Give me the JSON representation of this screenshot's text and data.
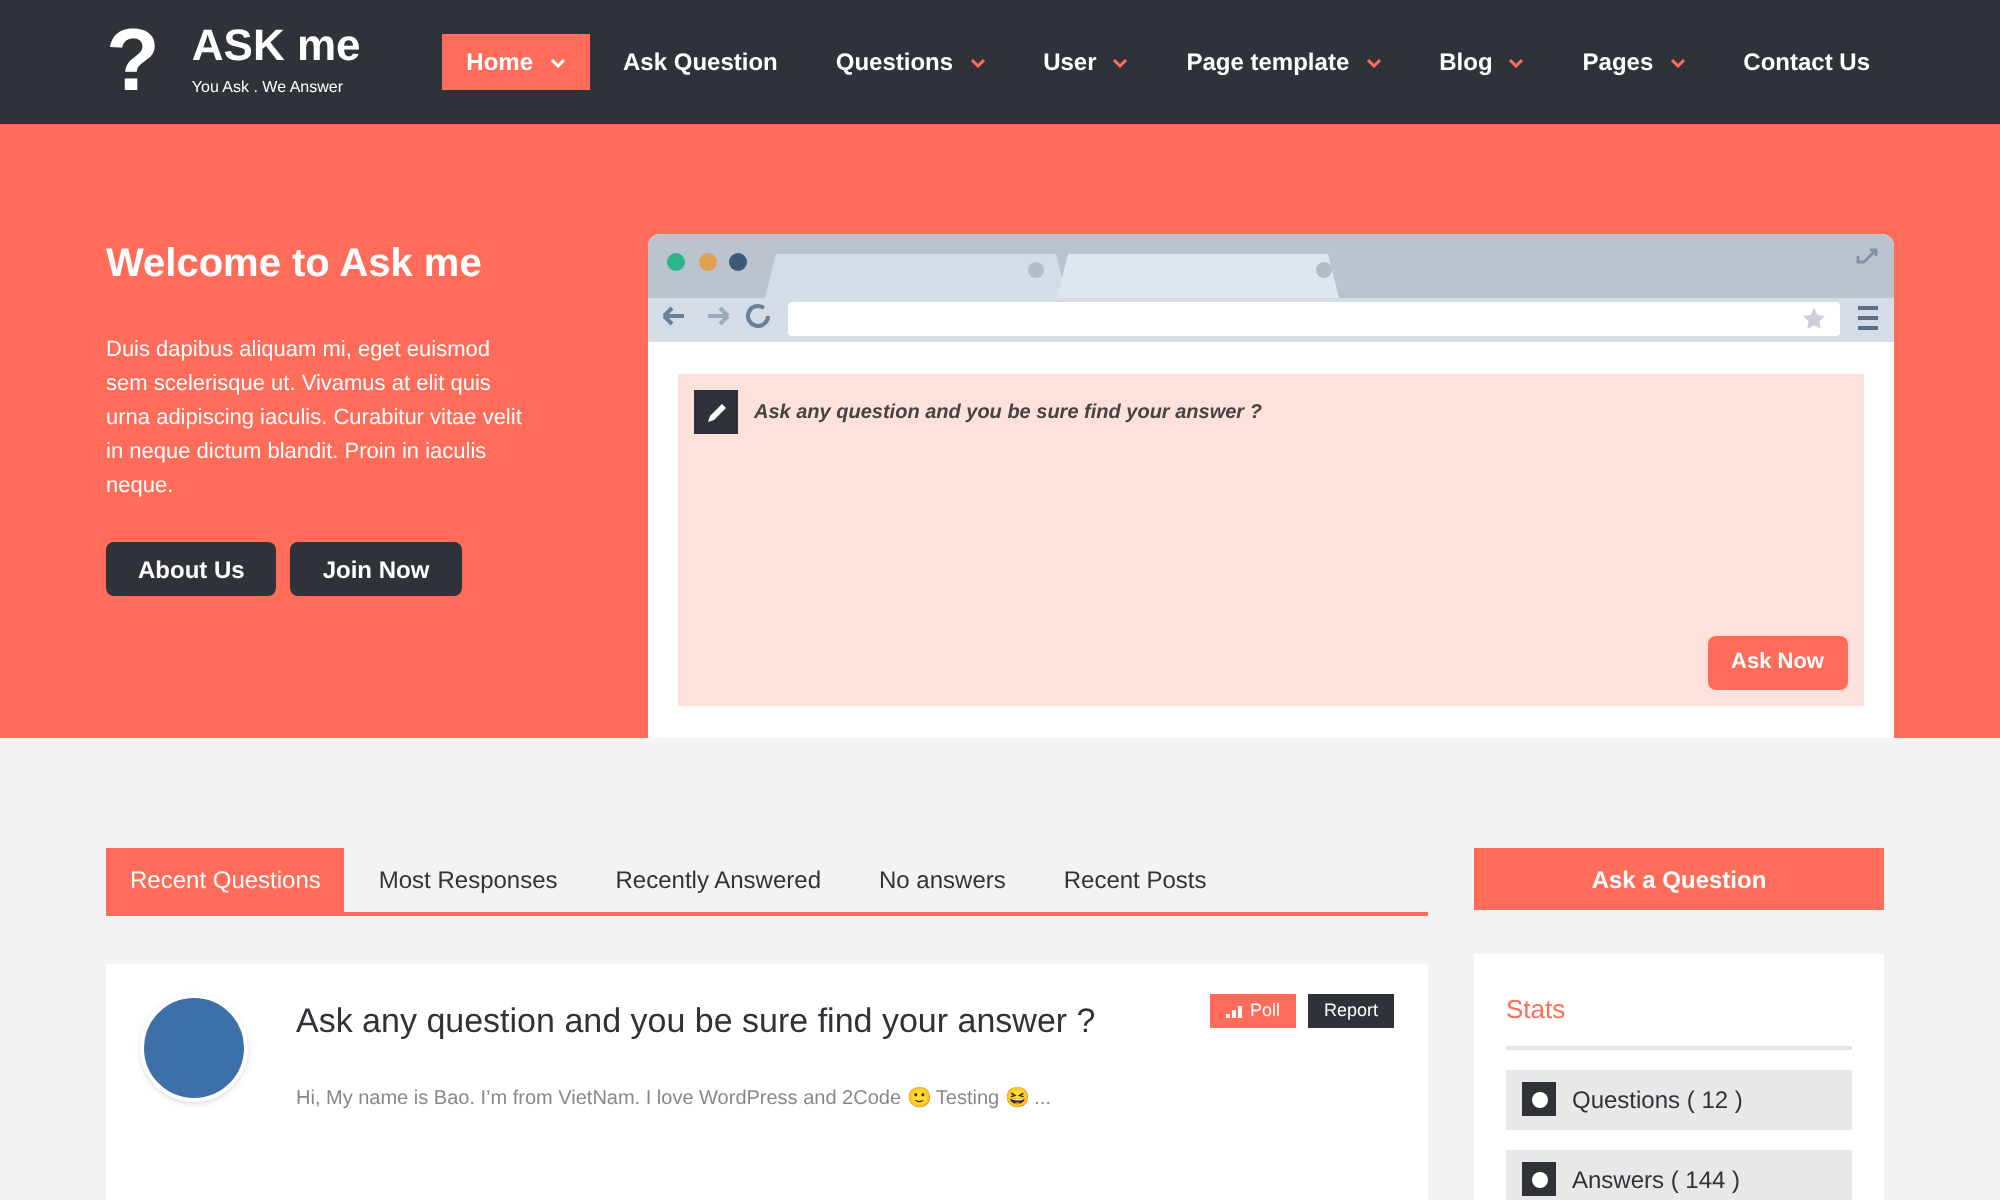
{
  "logo": {
    "mark": "?",
    "title": "ASK me",
    "tagline": "You Ask . We Answer"
  },
  "nav": [
    {
      "label": "Home",
      "selected": true,
      "dropdown": true
    },
    {
      "label": "Ask Question",
      "selected": false,
      "dropdown": false
    },
    {
      "label": "Questions",
      "selected": false,
      "dropdown": true
    },
    {
      "label": "User",
      "selected": false,
      "dropdown": true
    },
    {
      "label": "Page template",
      "selected": false,
      "dropdown": true
    },
    {
      "label": "Blog",
      "selected": false,
      "dropdown": true
    },
    {
      "label": "Pages",
      "selected": false,
      "dropdown": true
    },
    {
      "label": "Contact Us",
      "selected": false,
      "dropdown": false
    }
  ],
  "hero": {
    "title": "Welcome to Ask me",
    "text": "Duis dapibus aliquam mi, eget euismod sem scelerisque ut. Vivamus at elit quis urna adipiscing iaculis. Curabitur vitae velit in neque dictum blandit. Proin in iaculis neque.",
    "buttons": [
      "About Us",
      "Join Now"
    ],
    "ask_box": {
      "placeholder": "Ask any question and you be sure find your answer ?",
      "button": "Ask Now"
    }
  },
  "tabs": [
    {
      "label": "Recent Questions",
      "selected": true
    },
    {
      "label": "Most Responses",
      "selected": false
    },
    {
      "label": "Recently Answered",
      "selected": false
    },
    {
      "label": "No answers",
      "selected": false
    },
    {
      "label": "Recent Posts",
      "selected": false
    }
  ],
  "question": {
    "title": "Ask any question and you be sure find your answer ?",
    "badges": [
      {
        "label": "Poll",
        "kind": "poll"
      },
      {
        "label": "Report",
        "kind": "report"
      }
    ],
    "excerpt": "Hi, My name is Bao. I’m from VietNam. I love WordPress and 2Code 🙂 Testing 😆 ..."
  },
  "sidebar": {
    "button": "Ask a Question",
    "stats": {
      "title": "Stats",
      "items": [
        "Questions ( 12 )",
        "Answers ( 144 )"
      ]
    }
  }
}
